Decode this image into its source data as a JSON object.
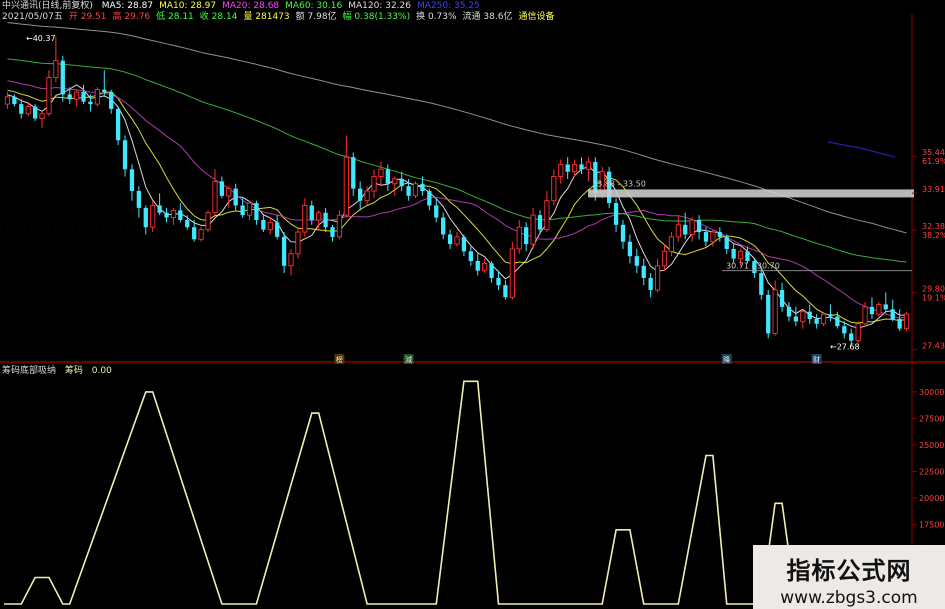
{
  "header": {
    "stock_title": "中兴通讯(日线,前复权)",
    "ma": [
      {
        "label": "MA5: 28.87",
        "color": "#ffffff"
      },
      {
        "label": "MA10: 28.97",
        "color": "#ffff40"
      },
      {
        "label": "MA20: 28.68",
        "color": "#ff40ff"
      },
      {
        "label": "MA60: 30.16",
        "color": "#40ff40"
      },
      {
        "label": "MA120: 32.26",
        "color": "#dddddd"
      },
      {
        "label": "MA250: 35.25",
        "color": "#4040ff"
      }
    ],
    "info": [
      {
        "text": "2021/05/07五",
        "color": "#dddddd"
      },
      {
        "text": "开 29.51",
        "color": "#ff4040"
      },
      {
        "text": "高 29.76",
        "color": "#ff4040"
      },
      {
        "text": "低 28.11",
        "color": "#40ff40"
      },
      {
        "text": "收 28.14",
        "color": "#40ff40"
      },
      {
        "text": "量 281473",
        "color": "#ffff40"
      },
      {
        "text": "额 7.98亿",
        "color": "#dddddd"
      },
      {
        "text": "幅 0.38(1.33%)",
        "color": "#40ff40"
      },
      {
        "text": "换 0.73%",
        "color": "#dddddd"
      },
      {
        "text": "流通 38.6亿",
        "color": "#dddddd"
      },
      {
        "text": "通信设备",
        "color": "#ffff40"
      }
    ]
  },
  "indicator_header": {
    "name": "筹码底部吸纳",
    "series_label": "筹码",
    "value": "0.00"
  },
  "annotations": {
    "high_label": "40.37",
    "low_label": "27.68",
    "zone1": "33.88 - 33.50",
    "zone2": "30.71 - 30.70",
    "markers": [
      "榜",
      "減",
      "降",
      "财"
    ]
  },
  "price_axis": {
    "ticks": [
      {
        "price": "35.44",
        "pct": "61.9%"
      },
      {
        "price": "33.91",
        "pct": ""
      },
      {
        "price": "32.38",
        "pct": "38.2%"
      },
      {
        "price": "29.80",
        "pct": "19.1%"
      },
      {
        "price": "27.43",
        "pct": ""
      }
    ]
  },
  "chart_data": [
    {
      "type": "line",
      "title": "中兴通讯(日线,前复权)",
      "y_ticks": [
        27.43,
        29.8,
        32.38,
        33.91,
        35.44
      ],
      "ylim": [
        27.0,
        41.0
      ],
      "n_days": 136,
      "candles": [
        [
          37.6,
          38.1,
          37.4,
          37.9
        ],
        [
          37.9,
          38.0,
          37.5,
          37.6
        ],
        [
          37.6,
          37.8,
          37.0,
          37.2
        ],
        [
          37.2,
          37.7,
          37.1,
          37.5
        ],
        [
          37.5,
          37.6,
          36.9,
          37.0
        ],
        [
          37.0,
          37.3,
          36.6,
          37.2
        ],
        [
          37.2,
          39.0,
          37.1,
          38.7
        ],
        [
          38.7,
          40.4,
          38.5,
          39.4
        ],
        [
          39.4,
          39.6,
          37.7,
          38.0
        ],
        [
          38.0,
          38.3,
          37.6,
          37.8
        ],
        [
          37.8,
          38.2,
          37.5,
          38.1
        ],
        [
          38.1,
          38.4,
          37.6,
          37.7
        ],
        [
          37.7,
          38.0,
          37.3,
          37.6
        ],
        [
          37.6,
          38.3,
          37.5,
          38.2
        ],
        [
          38.2,
          39.0,
          37.9,
          38.1
        ],
        [
          38.1,
          38.2,
          37.2,
          37.4
        ],
        [
          37.4,
          37.5,
          35.9,
          36.1
        ],
        [
          36.1,
          36.3,
          34.6,
          34.9
        ],
        [
          34.9,
          35.1,
          33.6,
          34.0
        ],
        [
          34.0,
          34.2,
          32.9,
          33.3
        ],
        [
          33.3,
          33.4,
          32.2,
          32.5
        ],
        [
          32.5,
          33.6,
          32.3,
          33.4
        ],
        [
          33.4,
          33.9,
          33.0,
          33.1
        ],
        [
          33.1,
          33.3,
          32.7,
          32.9
        ],
        [
          32.9,
          33.3,
          32.6,
          33.2
        ],
        [
          33.2,
          33.5,
          32.7,
          32.8
        ],
        [
          32.8,
          33.0,
          32.4,
          32.5
        ],
        [
          32.5,
          32.8,
          31.9,
          32.0
        ],
        [
          32.0,
          32.5,
          31.9,
          32.4
        ],
        [
          32.4,
          33.2,
          32.3,
          33.1
        ],
        [
          33.1,
          34.9,
          33.0,
          34.4
        ],
        [
          34.4,
          34.6,
          33.7,
          33.8
        ],
        [
          33.8,
          34.2,
          33.3,
          34.1
        ],
        [
          34.1,
          34.3,
          33.2,
          33.4
        ],
        [
          33.4,
          33.7,
          32.9,
          33.0
        ],
        [
          33.0,
          33.6,
          32.8,
          33.5
        ],
        [
          33.5,
          33.6,
          32.6,
          32.8
        ],
        [
          32.8,
          33.0,
          32.3,
          32.4
        ],
        [
          32.4,
          32.9,
          32.2,
          32.7
        ],
        [
          32.7,
          33.0,
          32.0,
          32.1
        ],
        [
          32.1,
          32.3,
          30.6,
          30.9
        ],
        [
          30.9,
          31.6,
          30.5,
          31.4
        ],
        [
          31.4,
          32.5,
          31.2,
          32.3
        ],
        [
          32.3,
          33.7,
          32.1,
          33.4
        ],
        [
          33.4,
          33.6,
          32.6,
          32.8
        ],
        [
          32.8,
          33.2,
          32.4,
          33.1
        ],
        [
          33.1,
          33.3,
          32.3,
          32.5
        ],
        [
          32.5,
          32.6,
          31.9,
          32.1
        ],
        [
          32.1,
          33.2,
          32.0,
          33.0
        ],
        [
          33.0,
          36.3,
          32.9,
          35.4
        ],
        [
          35.4,
          35.6,
          33.8,
          34.1
        ],
        [
          34.1,
          34.4,
          33.2,
          33.6
        ],
        [
          33.6,
          34.2,
          33.4,
          34.0
        ],
        [
          34.0,
          34.9,
          33.7,
          34.6
        ],
        [
          34.6,
          35.2,
          34.2,
          34.9
        ],
        [
          34.9,
          35.1,
          34.0,
          34.3
        ],
        [
          34.3,
          34.6,
          33.8,
          34.5
        ],
        [
          34.5,
          34.8,
          34.0,
          34.2
        ],
        [
          34.2,
          34.5,
          33.6,
          33.8
        ],
        [
          33.8,
          34.4,
          33.7,
          34.3
        ],
        [
          34.3,
          34.6,
          33.8,
          34.0
        ],
        [
          34.0,
          34.1,
          33.2,
          33.4
        ],
        [
          33.4,
          33.7,
          32.7,
          32.9
        ],
        [
          32.9,
          33.1,
          32.0,
          32.2
        ],
        [
          32.2,
          32.4,
          31.6,
          31.8
        ],
        [
          31.8,
          32.3,
          31.7,
          32.1
        ],
        [
          32.1,
          32.2,
          31.3,
          31.5
        ],
        [
          31.5,
          31.7,
          30.9,
          31.1
        ],
        [
          31.1,
          31.4,
          30.5,
          30.7
        ],
        [
          30.7,
          31.2,
          30.6,
          31.0
        ],
        [
          31.0,
          31.1,
          30.2,
          30.4
        ],
        [
          30.4,
          30.7,
          29.9,
          30.1
        ],
        [
          30.1,
          30.3,
          29.5,
          29.6
        ],
        [
          29.6,
          31.9,
          29.5,
          31.6
        ],
        [
          31.6,
          32.8,
          31.4,
          32.5
        ],
        [
          32.5,
          32.7,
          31.5,
          31.8
        ],
        [
          31.8,
          33.3,
          31.6,
          33.0
        ],
        [
          33.0,
          33.2,
          32.2,
          32.4
        ],
        [
          32.4,
          34.0,
          32.3,
          33.6
        ],
        [
          33.6,
          34.9,
          33.4,
          34.6
        ],
        [
          34.6,
          35.3,
          34.3,
          35.1
        ],
        [
          35.1,
          35.4,
          34.5,
          34.8
        ],
        [
          34.8,
          35.3,
          34.6,
          35.1
        ],
        [
          35.1,
          35.4,
          34.7,
          34.9
        ],
        [
          34.9,
          35.4,
          34.4,
          35.2
        ],
        [
          35.2,
          35.4,
          33.6,
          33.9
        ],
        [
          33.9,
          35.0,
          33.7,
          34.8
        ],
        [
          34.8,
          35.0,
          33.3,
          33.5
        ],
        [
          33.5,
          33.7,
          32.3,
          32.6
        ],
        [
          32.6,
          32.8,
          31.6,
          31.9
        ],
        [
          31.9,
          32.2,
          31.0,
          31.3
        ],
        [
          31.3,
          31.6,
          30.6,
          30.9
        ],
        [
          30.9,
          31.2,
          30.1,
          30.4
        ],
        [
          30.4,
          30.6,
          29.6,
          29.9
        ],
        [
          29.9,
          31.2,
          29.8,
          30.9
        ],
        [
          30.9,
          31.8,
          30.7,
          31.5
        ],
        [
          31.5,
          32.3,
          31.3,
          32.1
        ],
        [
          32.1,
          33.0,
          31.9,
          32.6
        ],
        [
          32.6,
          33.1,
          32.0,
          32.2
        ],
        [
          32.2,
          32.9,
          31.9,
          32.8
        ],
        [
          32.8,
          33.0,
          32.0,
          32.3
        ],
        [
          32.3,
          32.5,
          31.7,
          31.9
        ],
        [
          31.9,
          32.4,
          31.7,
          32.3
        ],
        [
          32.3,
          32.5,
          31.9,
          32.1
        ],
        [
          32.1,
          32.2,
          31.4,
          31.6
        ],
        [
          31.6,
          31.8,
          31.0,
          31.2
        ],
        [
          31.2,
          31.6,
          30.9,
          31.5
        ],
        [
          31.5,
          31.7,
          31.0,
          31.1
        ],
        [
          31.1,
          31.2,
          30.4,
          30.6
        ],
        [
          30.6,
          30.8,
          29.5,
          29.7
        ],
        [
          29.7,
          29.9,
          27.9,
          28.1
        ],
        [
          28.1,
          30.3,
          28.0,
          29.9
        ],
        [
          29.9,
          30.2,
          29.0,
          29.2
        ],
        [
          29.2,
          29.4,
          28.6,
          28.8
        ],
        [
          28.8,
          29.2,
          28.4,
          28.6
        ],
        [
          28.6,
          29.1,
          28.3,
          29.0
        ],
        [
          29.0,
          29.3,
          28.5,
          28.7
        ],
        [
          28.7,
          28.9,
          28.3,
          28.5
        ],
        [
          28.5,
          29.0,
          28.4,
          28.9
        ],
        [
          28.9,
          29.3,
          28.6,
          28.8
        ],
        [
          28.8,
          29.0,
          28.3,
          28.4
        ],
        [
          28.4,
          28.6,
          27.9,
          28.1
        ],
        [
          28.1,
          28.3,
          27.6,
          27.8
        ],
        [
          27.8,
          28.6,
          27.7,
          28.5
        ],
        [
          28.5,
          29.4,
          28.4,
          29.2
        ],
        [
          29.2,
          29.6,
          28.7,
          28.9
        ],
        [
          28.9,
          29.4,
          28.8,
          29.3
        ],
        [
          29.3,
          29.8,
          29.0,
          29.1
        ],
        [
          29.1,
          29.5,
          28.6,
          28.7
        ],
        [
          28.7,
          29.1,
          28.2,
          28.3
        ],
        [
          28.3,
          29.0,
          28.2,
          28.9
        ]
      ]
    },
    {
      "type": "area",
      "title": "筹码底部吸纳",
      "series_name": "筹码",
      "y_ticks": [
        12500,
        15000,
        17500,
        20000,
        22500,
        25000,
        27500,
        30000
      ],
      "ylim": [
        10000,
        31500
      ],
      "peaks": [
        {
          "start": 2,
          "peak_start": 4,
          "peak_end": 6,
          "end": 8,
          "value": 12500
        },
        {
          "start": 9,
          "peak_start": 20,
          "peak_end": 21,
          "end": 31,
          "value": 30000
        },
        {
          "start": 36,
          "peak_start": 44,
          "peak_end": 45,
          "end": 52,
          "value": 28000
        },
        {
          "start": 62,
          "peak_start": 66,
          "peak_end": 68,
          "end": 71,
          "value": 31000
        },
        {
          "start": 86,
          "peak_start": 88,
          "peak_end": 90,
          "end": 92,
          "value": 17000
        },
        {
          "start": 97,
          "peak_start": 101,
          "peak_end": 102,
          "end": 104,
          "value": 24000
        },
        {
          "start": 109,
          "peak_start": 111,
          "peak_end": 112,
          "end": 114,
          "value": 19500
        }
      ]
    }
  ],
  "watermark": {
    "title": "指标公式网",
    "url": "www.zbgs3.com"
  },
  "colors": {
    "up": "#ff3030",
    "down": "#40e8ff",
    "ma5": "#ffffff",
    "ma10": "#ffff40",
    "ma20": "#cc44cc",
    "ma60": "#44cc44",
    "ma120": "#aaaaaa",
    "ma250": "#2222aa",
    "indicator": "#f3eeb0",
    "grid": "#8b0000",
    "zone": "#cccccc"
  }
}
